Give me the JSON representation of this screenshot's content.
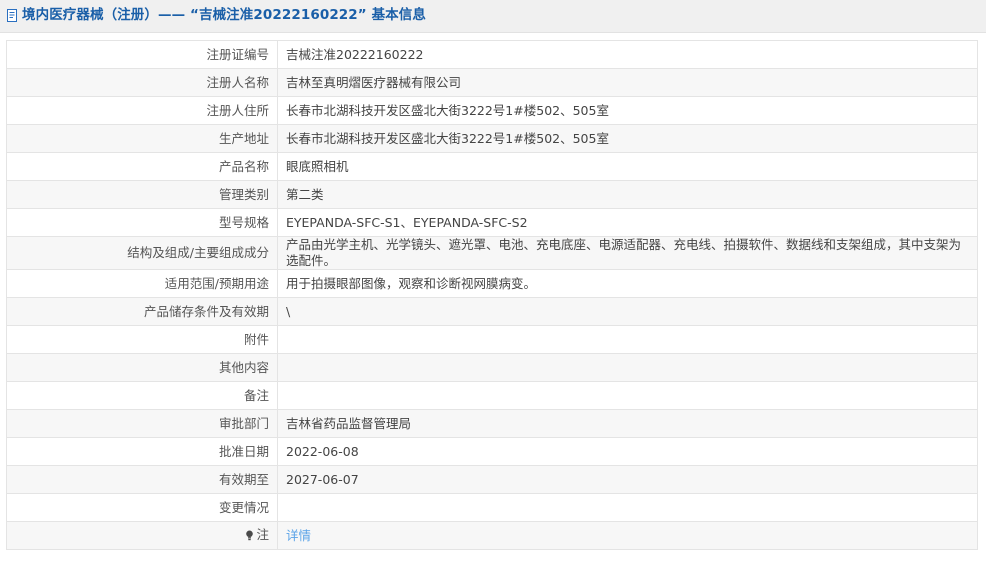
{
  "header": {
    "icon": "document-page-icon",
    "title": "境内医疗器械（注册）—— “吉械注准20222160222” 基本信息",
    "title_color": "#1a5fa8",
    "background_color": "#f0f0f0"
  },
  "table": {
    "rows": [
      {
        "label": "注册证编号",
        "value": "吉械注准20222160222"
      },
      {
        "label": "注册人名称",
        "value": "吉林至真明熠医疗器械有限公司"
      },
      {
        "label": "注册人住所",
        "value": "长春市北湖科技开发区盛北大街3222号1#楼502、505室"
      },
      {
        "label": "生产地址",
        "value": "长春市北湖科技开发区盛北大街3222号1#楼502、505室"
      },
      {
        "label": "产品名称",
        "value": "眼底照相机"
      },
      {
        "label": "管理类别",
        "value": "第二类"
      },
      {
        "label": "型号规格",
        "value": "EYEPANDA-SFC-S1、EYEPANDA-SFC-S2"
      },
      {
        "label": "结构及组成/主要组成成分",
        "value": "产品由光学主机、光学镜头、遮光罩、电池、充电底座、电源适配器、充电线、拍摄软件、数据线和支架组成，其中支架为选配件。"
      },
      {
        "label": "适用范围/预期用途",
        "value": "用于拍摄眼部图像，观察和诊断视网膜病变。"
      },
      {
        "label": "产品储存条件及有效期",
        "value": "\\"
      },
      {
        "label": "附件",
        "value": ""
      },
      {
        "label": "其他内容",
        "value": ""
      },
      {
        "label": "备注",
        "value": ""
      },
      {
        "label": "审批部门",
        "value": "吉林省药品监督管理局"
      },
      {
        "label": "批准日期",
        "value": "2022-06-08"
      },
      {
        "label": "有效期至",
        "value": "2027-06-07"
      },
      {
        "label": "变更情况",
        "value": ""
      }
    ],
    "note_row": {
      "icon": "bulb-note-icon",
      "label": "注",
      "link_label": "详情",
      "link_color": "#5aa3e8"
    }
  }
}
